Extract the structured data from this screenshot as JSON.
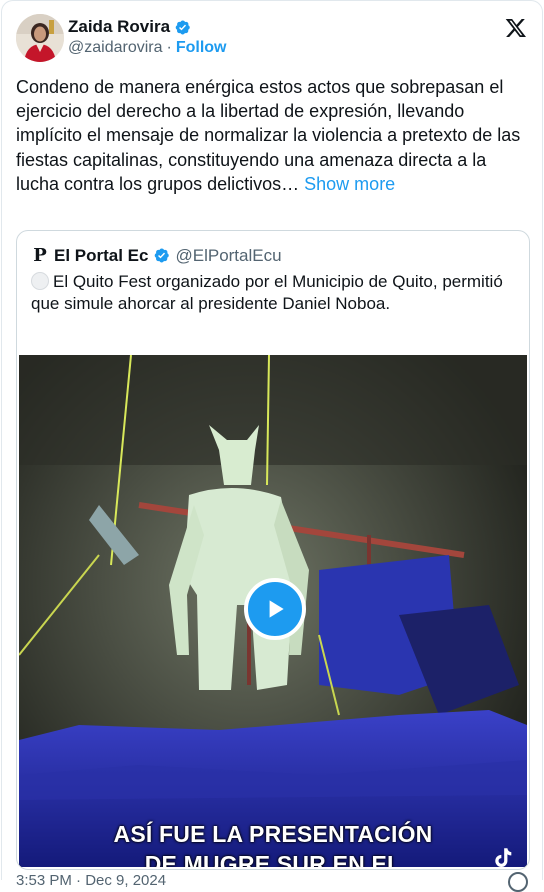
{
  "author": {
    "name": "Zaida Rovira",
    "handle": "@zaidarovira",
    "separator": "·",
    "follow_label": "Follow"
  },
  "tweet": {
    "text": "Condeno de manera enérgica estos actos que sobrepasan el ejercicio del derecho a la libertad de expresión, llevando implícito el mensaje de normalizar la violencia a pretexto de las fiestas capitalinas,  constituyendo una amenaza directa a la lucha contra los grupos delictivos…",
    "show_more_label": "Show more",
    "timestamp": "3:53 PM · Dec 9, 2024"
  },
  "quoted": {
    "logo_letter": "P",
    "name": "El Portal Ec",
    "handle": "@ElPortalEcu",
    "text": "El Quito Fest organizado por el Municipio de Quito, permitió que simule ahorcar al presidente Daniel Noboa.",
    "video_caption_line1": "ASÍ FUE LA PRESENTACIÓN",
    "video_caption_line2": "DE MUGRE SUR EN EL"
  },
  "icons": {
    "verified": "verified-badge-icon",
    "x_logo": "x-logo-icon",
    "play": "play-icon",
    "info": "info-icon",
    "tiktok": "tiktok-icon"
  },
  "colors": {
    "accent": "#1d9bf0",
    "text": "#0f1419",
    "muted": "#536471"
  }
}
